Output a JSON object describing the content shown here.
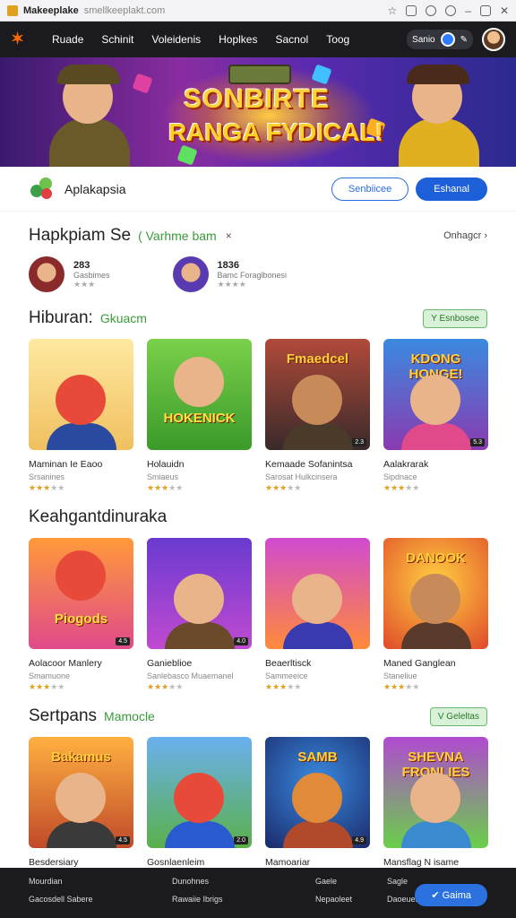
{
  "browser": {
    "title": "Makeeplake",
    "url": "smellkeeplakt.com"
  },
  "nav": {
    "items": [
      "Ruade",
      "Schinit",
      "Voleidenis",
      "Hoplkes",
      "Sacnol",
      "Toog"
    ],
    "toggle_label": "Sanio"
  },
  "hero": {
    "line1": "SONBIRTE",
    "line2": "RANGA FYDICAL!"
  },
  "appbar": {
    "name": "Aplakapsia",
    "outline_btn": "Senbiicee",
    "solid_btn": "Eshanal"
  },
  "section1": {
    "title": "Hapkpiam Se",
    "green": "( Varhme bam",
    "x": "×",
    "right": "Onhagcr ›"
  },
  "devs": [
    {
      "num": "283",
      "sub": "Gasbimes",
      "stars": "★★★"
    },
    {
      "num": "1836",
      "sub": "Bamc Foraglbonesi",
      "stars": "★★★★"
    }
  ],
  "section2": {
    "title": "Hiburan:",
    "green": "Gkuacm",
    "chip": "Y Esnbosee"
  },
  "row1": [
    {
      "name": "Maminan Ie Eaoo",
      "sub": "Srsanines",
      "rating": "★★★",
      "rest": "★★",
      "tag": ""
    },
    {
      "name": "Holauidn",
      "sub": "Smiaeus",
      "rating": "★★★",
      "rest": "★★",
      "tag": ""
    },
    {
      "name": "Kemaade Sofanintsa",
      "sub": "Sarosat Hulkcinsera",
      "rating": "★★★",
      "rest": "★★",
      "tag": "2.3"
    },
    {
      "name": "Aalakrarak",
      "sub": "Sipdnace",
      "rating": "★★★",
      "rest": "★★",
      "tag": "5.3"
    }
  ],
  "section3": {
    "title": "Keahgantdinuraka"
  },
  "row2": [
    {
      "name": "Aolacoor Manlery",
      "sub": "Smamuone",
      "rating": "★★★",
      "rest": "★★",
      "tag": "4.5"
    },
    {
      "name": "Ganieblioe",
      "sub": "Sanlebasco Muaemanel",
      "rating": "★★★",
      "rest": "★★",
      "tag": "4.0"
    },
    {
      "name": "Beaerltisck",
      "sub": "Sammeeice",
      "rating": "★★★",
      "rest": "★★",
      "tag": ""
    },
    {
      "name": "Maned Ganglean",
      "sub": "Staneliue",
      "rating": "★★★",
      "rest": "★★",
      "tag": ""
    }
  ],
  "section4": {
    "title": "Sertpans",
    "green": "Mamocle",
    "chip": "V Geleltas"
  },
  "row3": [
    {
      "name": "Besdersiary",
      "tag": "4.5"
    },
    {
      "name": "Gosnlaenleim",
      "tag": "2.0"
    },
    {
      "name": "Mamoariar",
      "tag": "4.9"
    },
    {
      "name": "Mansflag N isame",
      "tag": ""
    }
  ],
  "footer": {
    "c1": [
      "Mourdian",
      "Gacosdell Sabere"
    ],
    "c2": [
      "Dunohnes",
      "Rawaiie Ibrigs"
    ],
    "c3": [
      "Gaele",
      "Nepaoleet"
    ],
    "c4": [
      "Sagle",
      "Daoeues"
    ],
    "btn": "✔ Gaima"
  }
}
